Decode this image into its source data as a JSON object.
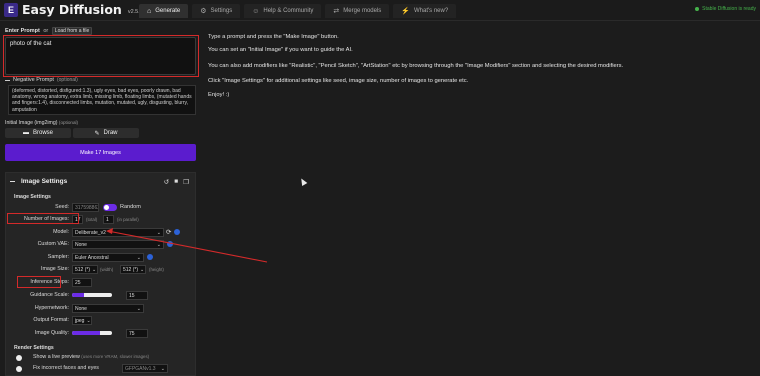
{
  "app": {
    "title": "Easy Diffusion",
    "version": "v2.5.26"
  },
  "tabs": [
    {
      "label": "Generate",
      "icon": "house-icon",
      "active": true
    },
    {
      "label": "Settings",
      "icon": "gear-icon"
    },
    {
      "label": "Help & Community",
      "icon": "people-icon"
    },
    {
      "label": "Merge models",
      "icon": "merge-icon"
    },
    {
      "label": "What's new?",
      "icon": "bolt-icon"
    }
  ],
  "status": "Stable Diffusion is ready",
  "prompt": {
    "label": "Enter Prompt",
    "or_text": "or",
    "load_button": "Load from a file",
    "value": "photo of the cat"
  },
  "negative": {
    "label": "Negative Prompt",
    "optional": "(optional)",
    "value": "(deformed, distorted, disfigured:1.3), ugly eyes, bad eyes, poorly drawn, bad anatomy, wrong anatomy, extra limb, missing limb, floating limbs, (mutated hands and fingers:1.4), disconnected limbs, mutation, mutated, ugly, disgusting, blurry, amputation"
  },
  "initial_image": {
    "label": "Initial Image (img2img)",
    "optional": "(optional)",
    "browse": "Browse",
    "draw": "Draw"
  },
  "make_button": "Make 17 Images",
  "image_settings": {
    "title": "Image Settings",
    "section_title": "Image Settings",
    "seed": {
      "label": "Seed:",
      "value": "3175988623",
      "random_label": "Random"
    },
    "num_images": {
      "label": "Number of Images:",
      "value": "17",
      "hint1": "(total)",
      "parallel": "1",
      "hint2": "(in parallel)"
    },
    "model": {
      "label": "Model:",
      "value": "Deliberate_v2"
    },
    "vae": {
      "label": "Custom VAE:",
      "value": "None"
    },
    "sampler": {
      "label": "Sampler:",
      "value": "Euler Ancestral"
    },
    "size": {
      "label": "Image Size:",
      "width": "512 (*)",
      "width_hint": "(width)",
      "height": "512 (*)",
      "height_hint": "(height)"
    },
    "steps": {
      "label": "Inference Steps:",
      "value": "25"
    },
    "guidance": {
      "label": "Guidance Scale:",
      "value": "15",
      "fraction": 0.3
    },
    "hypernetwork": {
      "label": "Hypernetwork:",
      "value": "None"
    },
    "output_format": {
      "label": "Output Format:",
      "value": "jpeg"
    },
    "quality": {
      "label": "Image Quality:",
      "value": "75",
      "fraction": 0.7
    }
  },
  "render_settings": {
    "title": "Render Settings",
    "live_preview": {
      "label": "Show a live preview",
      "hint": "(uses more VRAM, slower images)"
    },
    "fix_faces": {
      "label": "Fix incorrect faces and eyes",
      "value": "GFPGANv1.3"
    }
  },
  "instructions": [
    "Type a prompt and press the \"Make Image\" button.",
    "You can set an \"Initial Image\" if you want to guide the AI.",
    "You can also add modifiers like \"Realistic\", \"Pencil Sketch\", \"ArtStation\" etc by browsing through the \"Image Modifiers\" section and selecting the desired modifiers.",
    "Click \"Image Settings\" for additional settings like seed, image size, number of images to generate etc.",
    "Enjoy! :)"
  ],
  "colors": {
    "accent": "#5b1cce",
    "status": "#45b24b",
    "annotation": "#d42a2a"
  }
}
